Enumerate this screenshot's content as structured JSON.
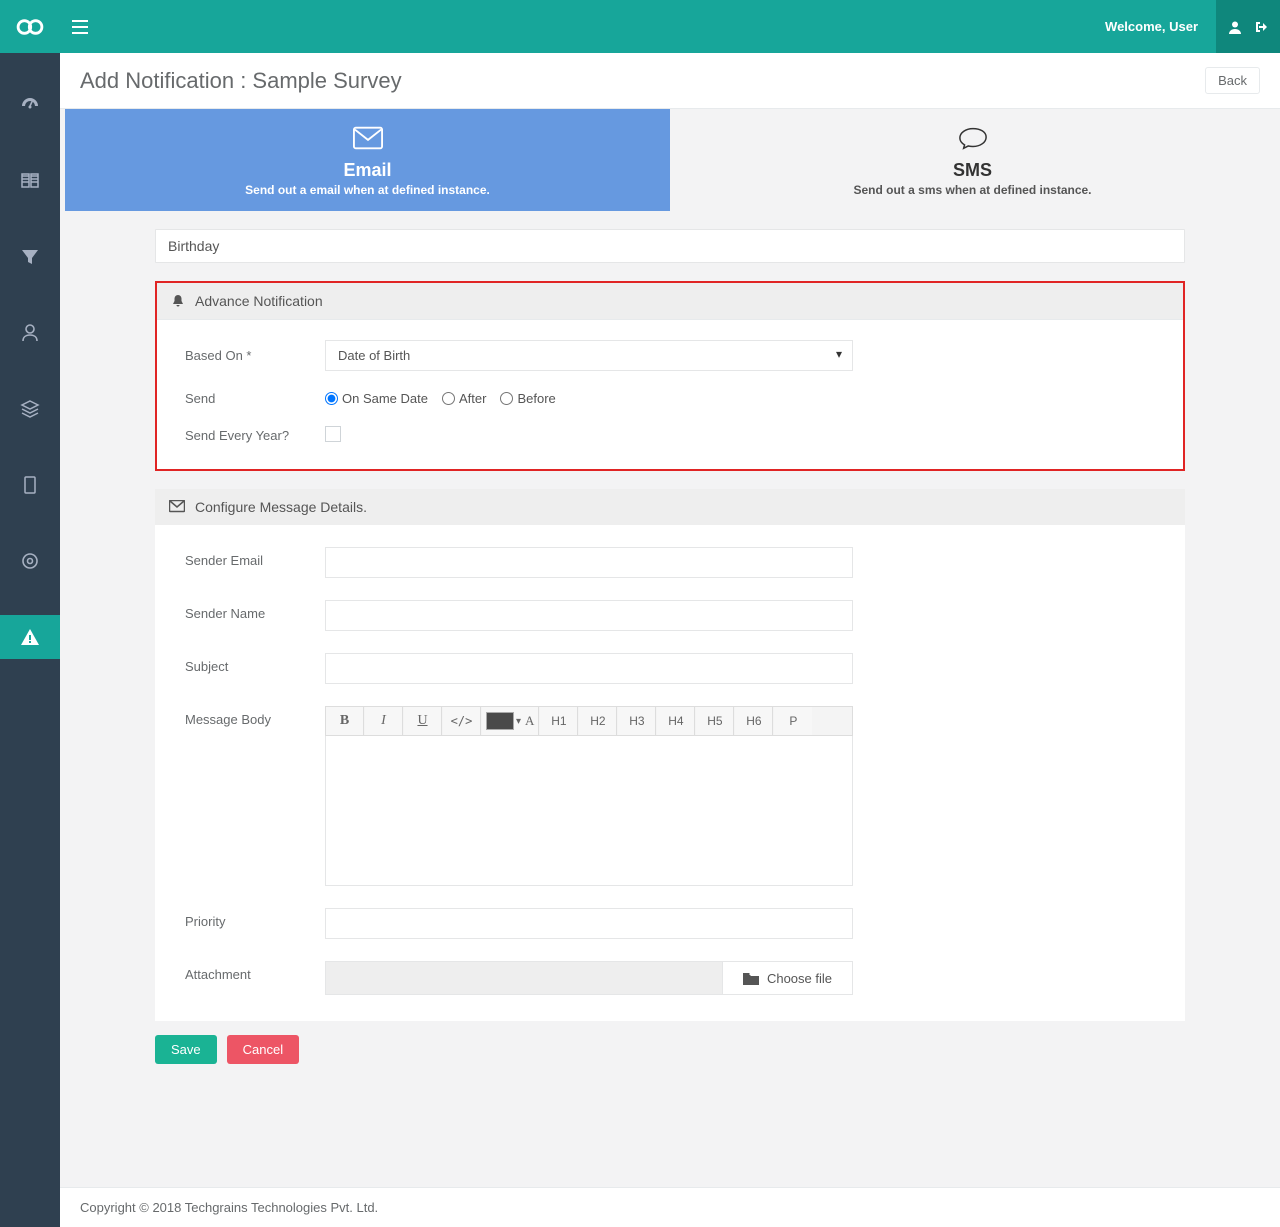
{
  "header": {
    "welcome": "Welcome, User"
  },
  "page": {
    "title": "Add Notification : Sample Survey",
    "back": "Back"
  },
  "tabs": {
    "email": {
      "title": "Email",
      "subtitle": "Send out a email when at defined instance."
    },
    "sms": {
      "title": "SMS",
      "subtitle": "Send out a sms when at defined instance."
    }
  },
  "notification_name": "Birthday",
  "advance": {
    "heading": "Advance Notification",
    "based_on_label": "Based On *",
    "based_on_value": "Date of Birth",
    "send_label": "Send",
    "options": {
      "same": "On Same Date",
      "after": "After",
      "before": "Before"
    },
    "selected_option": "same",
    "send_every_year_label": "Send Every Year?",
    "send_every_year": false
  },
  "configure": {
    "heading": "Configure Message Details.",
    "sender_email_label": "Sender Email",
    "sender_email": "",
    "sender_name_label": "Sender Name",
    "sender_name": "",
    "subject_label": "Subject",
    "subject": "",
    "message_body_label": "Message Body",
    "priority_label": "Priority",
    "priority": "",
    "attachment_label": "Attachment",
    "choose_file": "Choose file"
  },
  "toolbar": {
    "bold": "B",
    "italic": "I",
    "underline": "U",
    "code": "</>",
    "colorA": "A",
    "h1": "H1",
    "h2": "H2",
    "h3": "H3",
    "h4": "H4",
    "h5": "H5",
    "h6": "H6",
    "p": "P"
  },
  "actions": {
    "save": "Save",
    "cancel": "Cancel"
  },
  "footer": "Copyright © 2018 Techgrains Technologies Pvt. Ltd."
}
